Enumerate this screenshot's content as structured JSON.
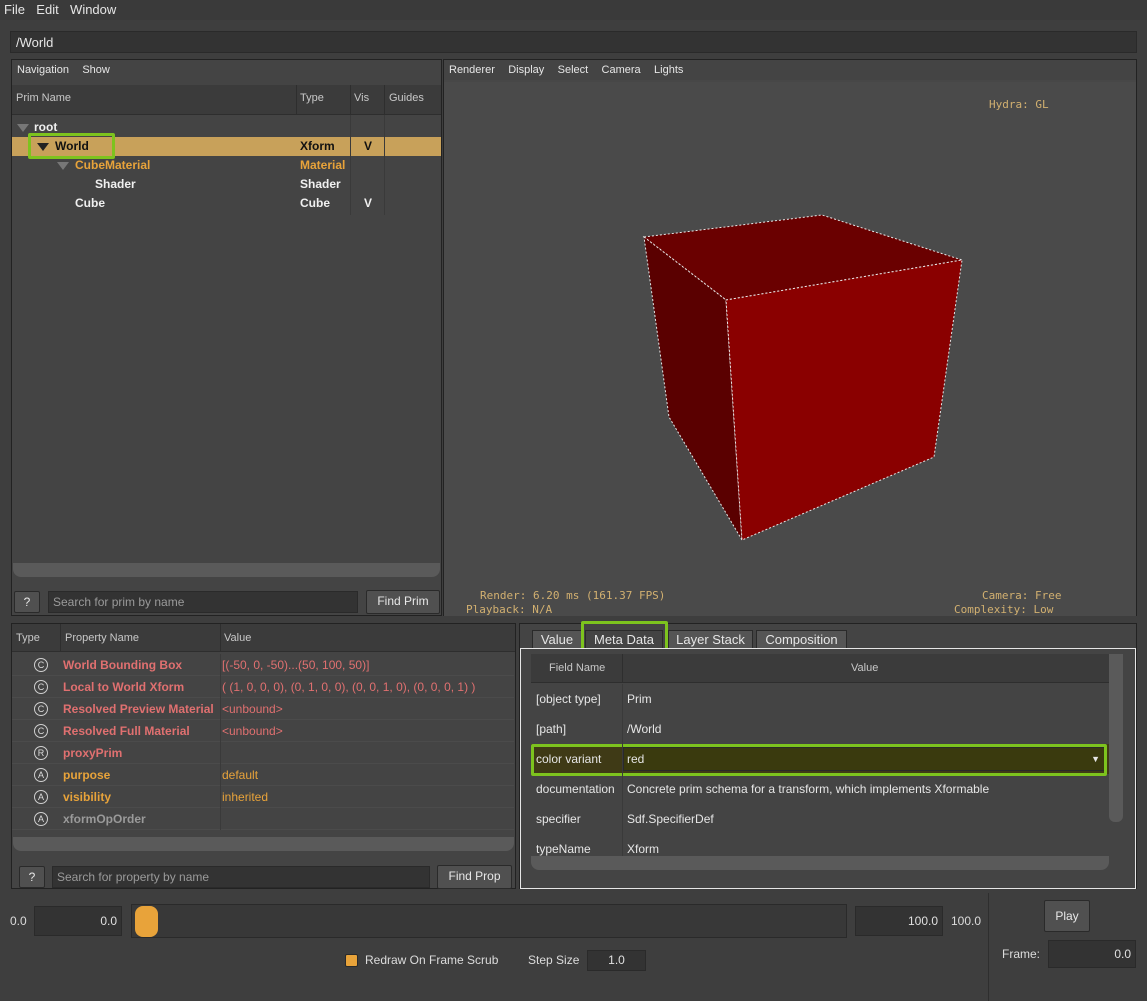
{
  "menu": [
    "File",
    "Edit",
    "Window"
  ],
  "path": "/World",
  "navigation": {
    "menu": [
      "Navigation",
      "Show"
    ],
    "columns": [
      "Prim Name",
      "Type",
      "Vis",
      "Guides"
    ],
    "rows": [
      {
        "name": "root",
        "type": "",
        "vis": ""
      },
      {
        "name": "World",
        "type": "Xform",
        "vis": "V"
      },
      {
        "name": "CubeMaterial",
        "type": "Material",
        "vis": ""
      },
      {
        "name": "Shader",
        "type": "Shader",
        "vis": ""
      },
      {
        "name": "Cube",
        "type": "Cube",
        "vis": "V"
      }
    ],
    "help": "?",
    "search_placeholder": "Search for prim by name",
    "find_label": "Find Prim"
  },
  "viewport": {
    "menu": [
      "Renderer",
      "Display",
      "Select",
      "Camera",
      "Lights"
    ],
    "hydra": "Hydra: GL",
    "render": "Render: 6.20 ms (161.37 FPS)",
    "playback": "Playback: N/A",
    "camera": "Camera: Free",
    "complexity": "Complexity: Low",
    "cube_color": "#8a0000"
  },
  "properties": {
    "columns": [
      "Type",
      "Property Name",
      "Value"
    ],
    "rows": [
      {
        "icon": "C",
        "name": "World Bounding Box",
        "value": "[(-50, 0, -50)...(50, 100, 50)]"
      },
      {
        "icon": "C",
        "name": "Local to World Xform",
        "value": "( (1, 0, 0, 0), (0, 1, 0, 0), (0, 0, 1, 0), (0, 0, 0, 1) )"
      },
      {
        "icon": "C",
        "name": "Resolved Preview Material",
        "value": "<unbound>"
      },
      {
        "icon": "C",
        "name": "Resolved Full Material",
        "value": "<unbound>"
      },
      {
        "icon": "R",
        "name": "proxyPrim",
        "value": ""
      },
      {
        "icon": "A",
        "name": "purpose",
        "value": "default"
      },
      {
        "icon": "A",
        "name": "visibility",
        "value": "inherited"
      },
      {
        "icon": "A",
        "name": "xformOpOrder",
        "value": ""
      }
    ],
    "help": "?",
    "search_placeholder": "Search for property by name",
    "find_label": "Find Prop"
  },
  "inspector": {
    "tabs": [
      "Value",
      "Meta Data",
      "Layer Stack",
      "Composition"
    ],
    "columns": [
      "Field Name",
      "Value"
    ],
    "rows": [
      {
        "field": "[object type]",
        "value": "Prim"
      },
      {
        "field": "[path]",
        "value": "/World"
      },
      {
        "field": "color variant",
        "value": "red"
      },
      {
        "field": "documentation",
        "value": "Concrete prim schema for a transform, which implements Xformable"
      },
      {
        "field": "specifier",
        "value": "Sdf.SpecifierDef"
      },
      {
        "field": "typeName",
        "value": "Xform"
      }
    ]
  },
  "timeline": {
    "start_label": "0.0",
    "start_value": "0.0",
    "end_value": "100.0",
    "end_label": "100.0",
    "play_label": "Play",
    "frame_label": "Frame:",
    "frame_value": "0.0",
    "redraw_label": "Redraw On Frame Scrub",
    "step_label": "Step Size",
    "step_value": "1.0"
  },
  "colors": {
    "accent": "#e8a33a",
    "highlight": "#8ac926",
    "selection": "#c8a15a"
  }
}
